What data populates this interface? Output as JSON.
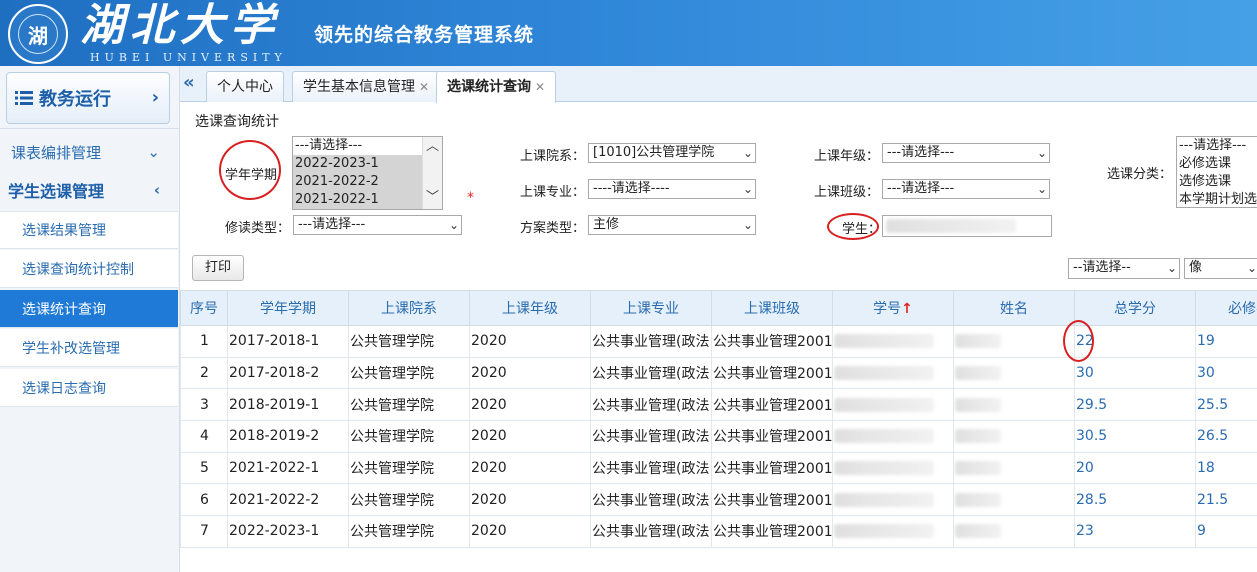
{
  "header": {
    "logo_text": "湖北大学",
    "logo_sub": "HUBEI UNIVERSITY",
    "seal_glyph": "湖",
    "system_title": "领先的综合教务管理系统"
  },
  "sidebar": {
    "module_label": "教务运行",
    "groups": [
      {
        "label": "课表编排管理"
      },
      {
        "label": "学生选课管理"
      }
    ],
    "items": [
      {
        "label": "选课结果管理"
      },
      {
        "label": "选课查询统计控制"
      },
      {
        "label": "选课统计查询"
      },
      {
        "label": "学生补改选管理"
      },
      {
        "label": "选课日志查询"
      }
    ]
  },
  "tabs": [
    {
      "label": "个人中心"
    },
    {
      "label": "学生基本信息管理"
    },
    {
      "label": "选课统计查询"
    }
  ],
  "filters": {
    "panel_title": "选课查询统计",
    "term_label": "学年学期",
    "term_options": [
      "---请选择---",
      "2022-2023-1",
      "2021-2022-2",
      "2021-2022-1"
    ],
    "college_label": "上课院系：",
    "college_value": "[1010]公共管理学院",
    "grade_label": "上课年级：",
    "grade_value": "---请选择---",
    "category_label": "选课分类：",
    "category_options": [
      "---请选择---",
      "必修选课",
      "选修选课",
      "本学期计划选"
    ],
    "major_label": "上课专业：",
    "major_value": "----请选择----",
    "class_label": "上课班级：",
    "class_value": "---请选择---",
    "study_type_label": "修读类型：",
    "study_type_value": "---请选择---",
    "plan_type_label": "方案类型：",
    "plan_type_value": "主修",
    "student_label": "学生：",
    "right_select_value": "--请选择--",
    "right_select2_value": "像"
  },
  "toolbar": {
    "print_label": "打印"
  },
  "table": {
    "headers": [
      "序号",
      "学年学期",
      "上课院系",
      "上课年级",
      "上课专业",
      "上课班级",
      "学号",
      "姓名",
      "总学分",
      "必修学分"
    ],
    "rows": [
      {
        "no": "1",
        "term": "2017-2018-1",
        "college": "公共管理学院",
        "grade": "2020",
        "major": "公共事业管理(政法",
        "class": "公共事业管理2001",
        "total": "22",
        "required": "19"
      },
      {
        "no": "2",
        "term": "2017-2018-2",
        "college": "公共管理学院",
        "grade": "2020",
        "major": "公共事业管理(政法",
        "class": "公共事业管理2001",
        "total": "30",
        "required": "30"
      },
      {
        "no": "3",
        "term": "2018-2019-1",
        "college": "公共管理学院",
        "grade": "2020",
        "major": "公共事业管理(政法",
        "class": "公共事业管理2001",
        "total": "29.5",
        "required": "25.5"
      },
      {
        "no": "4",
        "term": "2018-2019-2",
        "college": "公共管理学院",
        "grade": "2020",
        "major": "公共事业管理(政法",
        "class": "公共事业管理2001",
        "total": "30.5",
        "required": "26.5"
      },
      {
        "no": "5",
        "term": "2021-2022-1",
        "college": "公共管理学院",
        "grade": "2020",
        "major": "公共事业管理(政法",
        "class": "公共事业管理2001",
        "total": "20",
        "required": "18"
      },
      {
        "no": "6",
        "term": "2021-2022-2",
        "college": "公共管理学院",
        "grade": "2020",
        "major": "公共事业管理(政法",
        "class": "公共事业管理2001",
        "total": "28.5",
        "required": "21.5"
      },
      {
        "no": "7",
        "term": "2022-2023-1",
        "college": "公共管理学院",
        "grade": "2020",
        "major": "公共事业管理(政法",
        "class": "公共事业管理2001",
        "total": "23",
        "required": "9"
      }
    ]
  },
  "colors": {
    "accent": "#1e7ad6",
    "link": "#2a6cb0",
    "annotation": "#d82020"
  }
}
